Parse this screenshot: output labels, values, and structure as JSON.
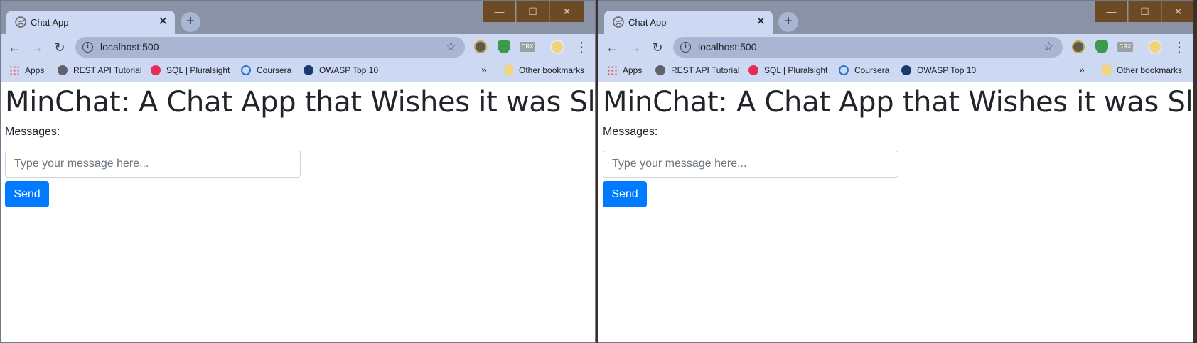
{
  "windows": [
    {
      "tab": {
        "title": "Chat App",
        "close": "✕"
      },
      "new_tab": "+",
      "window_controls": {
        "minimize": "—",
        "maximize": "☐",
        "close": "✕"
      },
      "toolbar": {
        "back": "←",
        "forward": "→",
        "reload": "↻",
        "url": "localhost:500",
        "info": "i",
        "bookmark_star": "☆",
        "menu": "⋮",
        "ext_crx": "CRX"
      },
      "bookmarks": [
        {
          "label": "Apps",
          "icon": "apps-grid-icon",
          "color": "#e8453c"
        },
        {
          "label": "REST API Tutorial",
          "icon": "globe-icon",
          "color": "#5f6368"
        },
        {
          "label": "SQL | Pluralsight",
          "icon": "pluralsight-icon",
          "color": "#e82c58"
        },
        {
          "label": "Coursera",
          "icon": "coursera-icon",
          "color": "#2a73cc"
        },
        {
          "label": "OWASP Top 10",
          "icon": "owasp-icon",
          "color": "#1b3a6b"
        }
      ],
      "bookmarks_overflow": "»",
      "other_bookmarks": "Other bookmarks",
      "page": {
        "heading": "MinChat: A Chat App that Wishes it was Slack",
        "messages_label": "Messages:",
        "input_placeholder": "Type your message here...",
        "send_label": "Send"
      }
    },
    {
      "tab": {
        "title": "Chat App",
        "close": "✕"
      },
      "new_tab": "+",
      "window_controls": {
        "minimize": "—",
        "maximize": "☐",
        "close": "✕"
      },
      "toolbar": {
        "back": "←",
        "forward": "→",
        "reload": "↻",
        "url": "localhost:500",
        "info": "i",
        "bookmark_star": "☆",
        "menu": "⋮",
        "ext_crx": "CRX"
      },
      "bookmarks": [
        {
          "label": "Apps",
          "icon": "apps-grid-icon",
          "color": "#e8453c"
        },
        {
          "label": "REST API Tutorial",
          "icon": "globe-icon",
          "color": "#5f6368"
        },
        {
          "label": "SQL | Pluralsight",
          "icon": "pluralsight-icon",
          "color": "#e82c58"
        },
        {
          "label": "Coursera",
          "icon": "coursera-icon",
          "color": "#2a73cc"
        },
        {
          "label": "OWASP Top 10",
          "icon": "owasp-icon",
          "color": "#1b3a6b"
        }
      ],
      "bookmarks_overflow": "»",
      "other_bookmarks": "Other bookmarks",
      "page": {
        "heading": "MinChat: A Chat App that Wishes it was Slack",
        "messages_label": "Messages:",
        "input_placeholder": "Type your message here...",
        "send_label": "Send"
      }
    }
  ],
  "colors": {
    "accent": "#007bff",
    "chrome_tab": "#cdd8f2",
    "titlebar": "#8a93a6",
    "window_controls": "#6b4a25"
  }
}
